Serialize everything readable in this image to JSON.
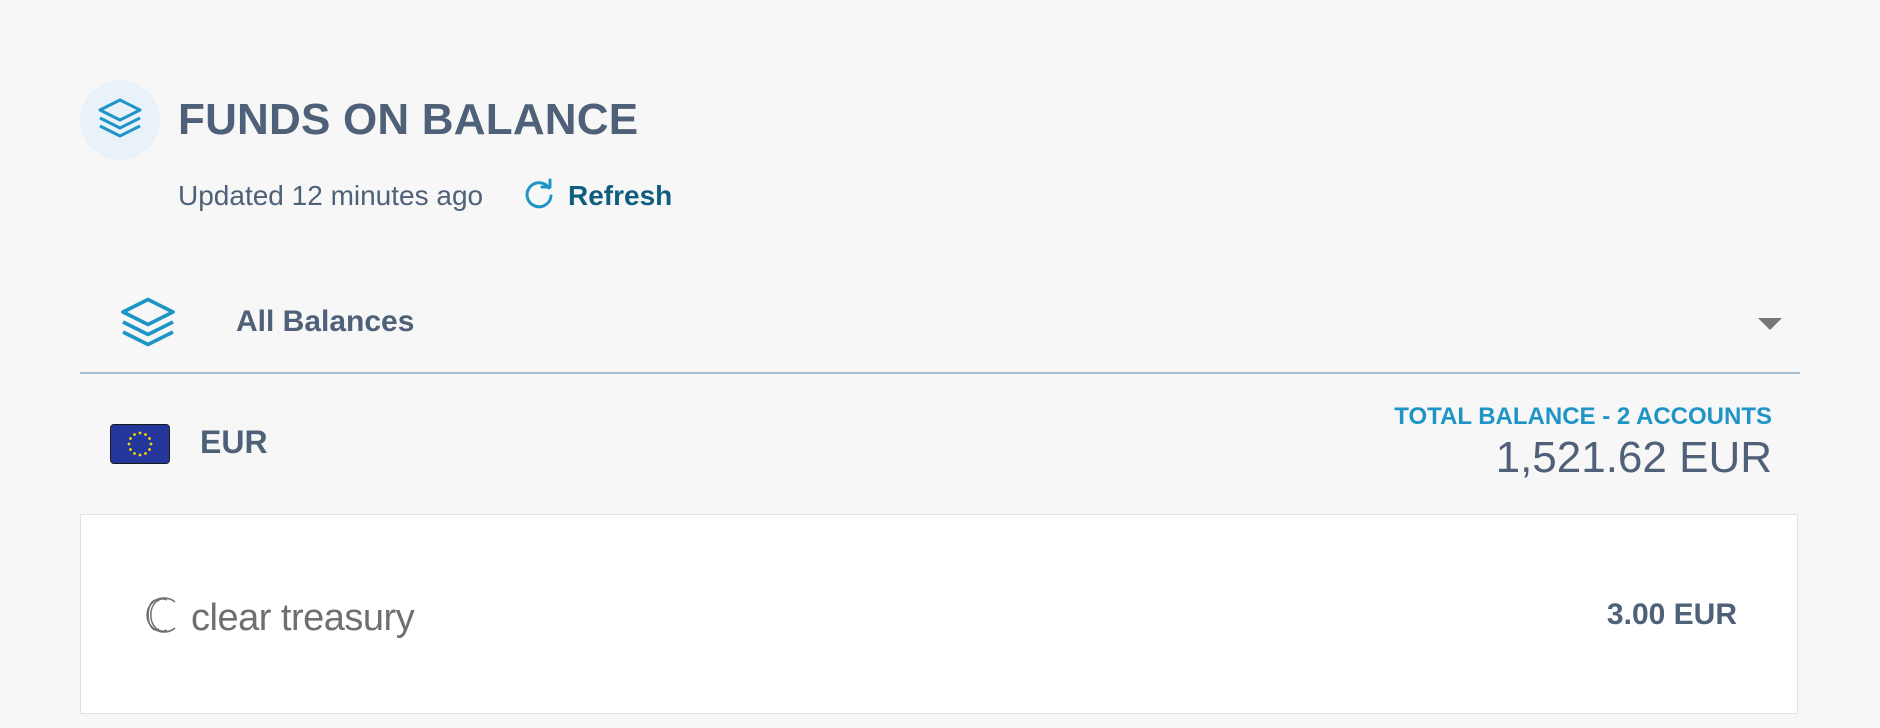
{
  "header": {
    "icon": "layers-icon",
    "title": "FUNDS ON BALANCE",
    "updated": "Updated 12 minutes ago",
    "refresh_label": "Refresh",
    "refresh_icon": "refresh-icon"
  },
  "balances_select": {
    "icon": "layers-icon",
    "selected": "All Balances",
    "caret_icon": "caret-down-icon"
  },
  "currency": {
    "flag_icon": "eu-flag-icon",
    "code": "EUR",
    "total_label": "TOTAL BALANCE - 2 ACCOUNTS",
    "total_value": "1,521.62 EUR"
  },
  "accounts": [
    {
      "provider_name": "clear treasury",
      "provider_icon": "clear-treasury-logo-icon",
      "amount": "3.00 EUR"
    }
  ],
  "colors": {
    "background": "#f7f7f7",
    "text_primary": "#4e6178",
    "accent_blue": "#1e95c6",
    "link_dark_blue": "#0f5e80",
    "icon_circle_bg": "#e8f2f8",
    "divider": "#a9bfd0",
    "card_bg": "#ffffff"
  }
}
